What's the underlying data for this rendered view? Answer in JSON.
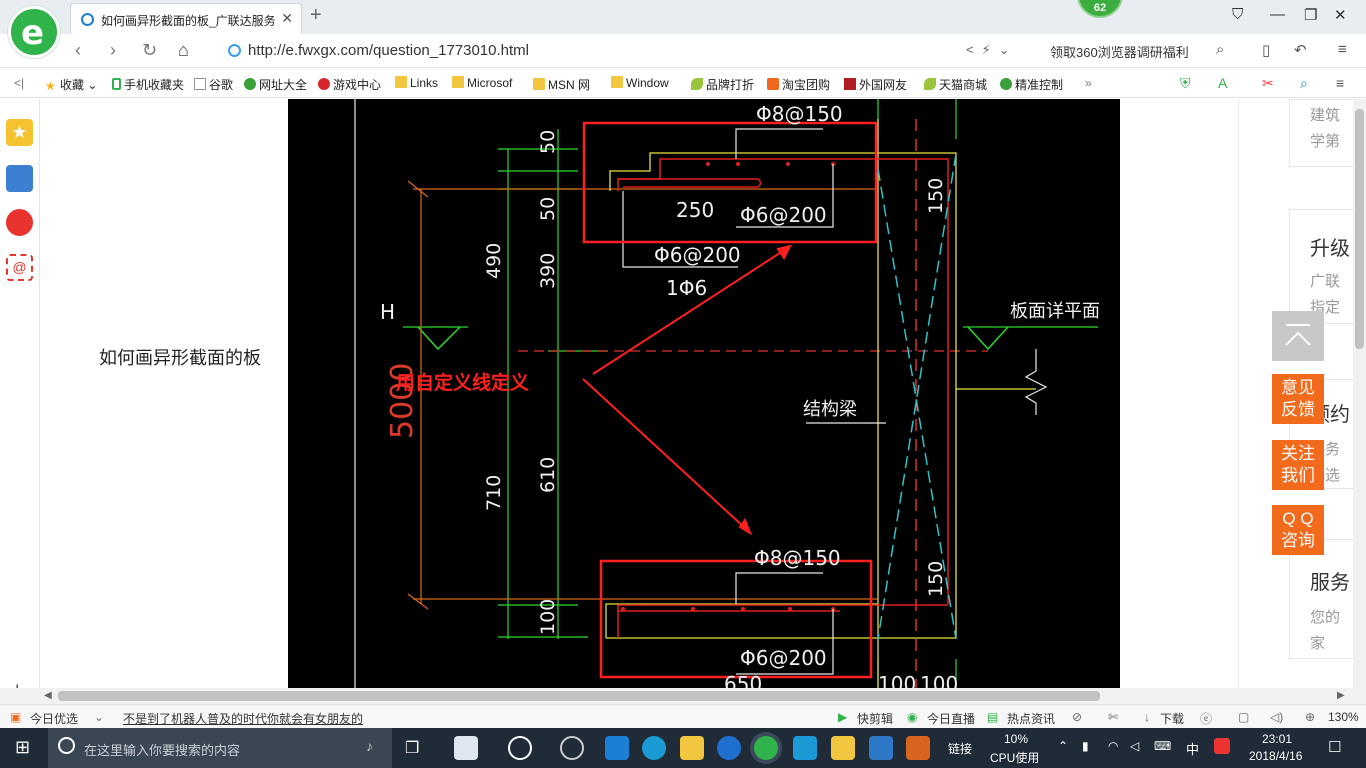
{
  "browser": {
    "tab_title": "如何画异形截面的板_广联达服务",
    "url": "http://e.fwxgx.com/question_1773010.html",
    "counter_badge": "62",
    "promo": "领取360浏览器调研福利"
  },
  "bookmarks": [
    {
      "label": "收藏",
      "icon": "star-icon"
    },
    {
      "label": "手机收藏夹",
      "icon": "phone-icon"
    },
    {
      "label": "谷歌",
      "icon": "page-icon"
    },
    {
      "label": "网址大全",
      "icon": "globe-icon"
    },
    {
      "label": "游戏中心",
      "icon": "game-icon"
    },
    {
      "label": "Links",
      "icon": "folder-icon"
    },
    {
      "label": "Microsof",
      "icon": "folder-icon"
    },
    {
      "label": "MSN 网",
      "icon": "folder-icon"
    },
    {
      "label": "Window",
      "icon": "folder-icon"
    },
    {
      "label": "品牌打折",
      "icon": "leaf-icon"
    },
    {
      "label": "淘宝团购",
      "icon": "taobao-icon"
    },
    {
      "label": "外国网友",
      "icon": "bookmark-icon"
    },
    {
      "label": "天猫商城",
      "icon": "leaf-icon"
    },
    {
      "label": "精准控制",
      "icon": "chat-icon"
    }
  ],
  "page": {
    "heading": "如何画异形截面的板",
    "cad": {
      "labels": {
        "rebar_top_1": "Φ8@150",
        "rebar_top_2": "Φ6@200",
        "rebar_top_3": "Φ6@200",
        "rebar_top_4": "1Φ6",
        "dim_250": "250",
        "rebar_bot_1": "Φ8@150",
        "rebar_bot_2": "Φ6@200",
        "dim_650": "650",
        "dim_100a": "100",
        "dim_100b": "100",
        "dim_150a": "150",
        "dim_150b": "150",
        "dim_50a": "50",
        "dim_50b": "50",
        "dim_390": "390",
        "dim_610": "610",
        "dim_490": "490",
        "dim_710": "710",
        "dim_100c": "100",
        "dim_5000": "5000",
        "H": "H",
        "slab_section": "板面详平面",
        "beam": "结构梁",
        "annotation": "用自定义线定义"
      }
    },
    "right_col": {
      "items": [
        {
          "title": "",
          "sub1": "建筑",
          "sub2": "学第"
        },
        {
          "title": "升级",
          "sub1": "广联",
          "sub2": "指定"
        },
        {
          "title": "预约",
          "sub1": "服务",
          "sub2": "心选"
        },
        {
          "title": "服务",
          "sub1": "您的",
          "sub2": "家"
        }
      ]
    },
    "float_buttons": {
      "feedback": [
        "意见",
        "反馈"
      ],
      "follow": [
        "关注",
        "我们"
      ],
      "qq": [
        "Q Q",
        "咨询"
      ]
    }
  },
  "status": {
    "today": "今日优选",
    "news": "不是到了机器人普及的时代你就会有女朋友的",
    "clip": "快剪辑",
    "live": "今日直播",
    "hot": "热点资讯",
    "download": "下载",
    "zoom": "130%"
  },
  "taskbar": {
    "search_placeholder": "在这里输入你要搜索的内容",
    "links": "链接",
    "cpu_value": "10%",
    "cpu_label": "CPU使用",
    "ime": "中",
    "time": "23:01",
    "date": "2018/4/16"
  }
}
